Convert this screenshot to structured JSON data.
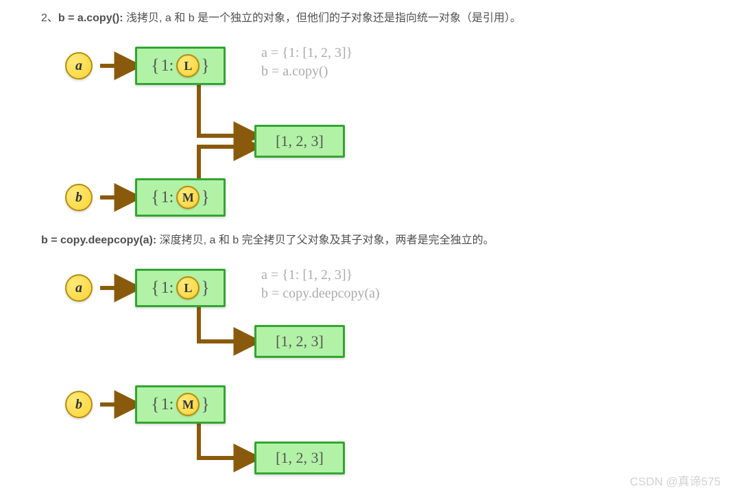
{
  "section1": {
    "heading_prefix": "2、",
    "heading_bold": "b = a.copy(): ",
    "heading_rest": "浅拷贝, a 和 b 是一个独立的对象，但他们的子对象还是指向统一对象（是引用）。",
    "var_a": "a",
    "var_b": "b",
    "dict_a_open": "{",
    "dict_a_key": "1:",
    "dict_a_ref": "L",
    "dict_a_close": "}",
    "dict_b_open": "{",
    "dict_b_key": "1:",
    "dict_b_ref": "M",
    "dict_b_close": "}",
    "list_content": "[1, 2, 3]",
    "note_line1": "a = {1: [1, 2, 3]}",
    "note_line2": "b = a.copy()"
  },
  "section2": {
    "heading_bold": "b = copy.deepcopy(a): ",
    "heading_rest": "深度拷贝, a 和 b 完全拷贝了父对象及其子对象，两者是完全独立的。",
    "var_a": "a",
    "var_b": "b",
    "dict_a_open": "{",
    "dict_a_key": "1:",
    "dict_a_ref": "L",
    "dict_a_close": "}",
    "dict_b_open": "{",
    "dict_b_key": "1:",
    "dict_b_ref": "M",
    "dict_b_close": "}",
    "list_a_content": "[1, 2, 3]",
    "list_b_content": "[1, 2, 3]",
    "note_line1": "a = {1: [1, 2, 3]}",
    "note_line2": "b = copy.deepcopy(a)"
  },
  "watermark": "CSDN @真谛575",
  "colors": {
    "arrow": "#8a5a0c",
    "box_border": "#32a532",
    "box_fill": "#b2f2a6",
    "circle_fill": "#fcd535",
    "circle_border": "#b28d12"
  }
}
